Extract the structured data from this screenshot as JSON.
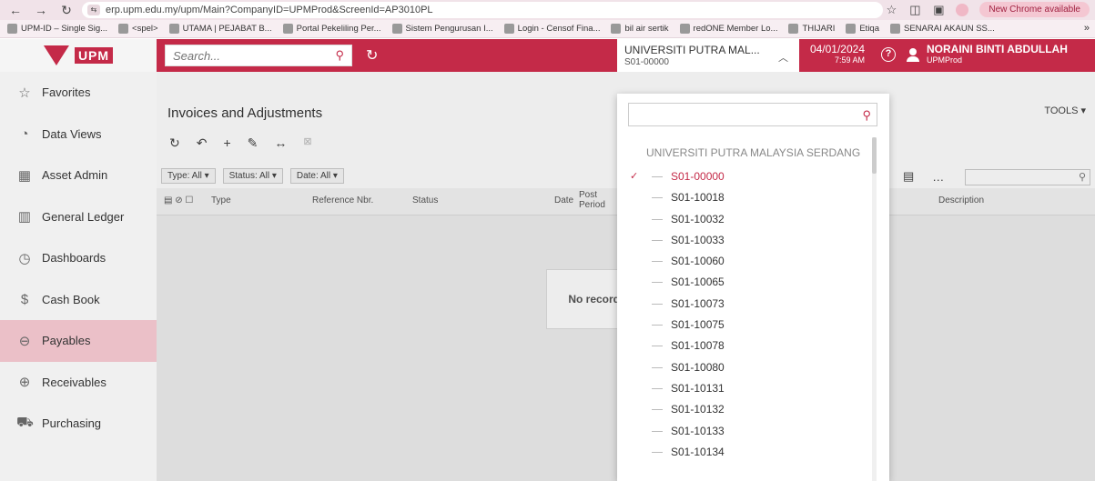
{
  "browser": {
    "url": "erp.upm.edu.my/upm/Main?CompanyID=UPMProd&ScreenId=AP3010PL",
    "update_label": "New Chrome available",
    "bookmarks": [
      "UPM-ID – Single Sig...",
      "<spel>",
      "UTAMA | PEJABAT B...",
      "Portal Pekeliling Per...",
      "Sistem Pengurusan I...",
      "Login - Censof Fina...",
      "bil air sertik",
      "redONE Member Lo...",
      "THIJARI",
      "Etiqa",
      "SENARAI AKAUN SS..."
    ],
    "more": "»"
  },
  "header": {
    "logo_text": "UPM",
    "search_placeholder": "Search...",
    "company_name": "UNIVERSITI PUTRA MAL...",
    "company_code": "S01-00000",
    "date": "04/01/2024",
    "time": "7:59 AM",
    "user_name": "NORAINI BINTI ABDULLAH",
    "user_company": "UPMProd"
  },
  "sidebar": {
    "items": [
      {
        "label": "Favorites",
        "icon": "☆"
      },
      {
        "label": "Data Views",
        "icon": "◔"
      },
      {
        "label": "Asset Admin",
        "icon": "▦"
      },
      {
        "label": "General Ledger",
        "icon": "▥"
      },
      {
        "label": "Dashboards",
        "icon": "◷"
      },
      {
        "label": "Cash Book",
        "icon": "$"
      },
      {
        "label": "Payables",
        "icon": "⊖"
      },
      {
        "label": "Receivables",
        "icon": "⊕"
      },
      {
        "label": "Purchasing",
        "icon": "⛟"
      }
    ]
  },
  "main": {
    "title": "Invoices and Adjustments",
    "tools_label": "TOOLS ▾",
    "filters": [
      "Type: All ▾",
      "Status: All ▾",
      "Date: All ▾"
    ],
    "columns": {
      "type": "Type",
      "ref": "Reference Nbr.",
      "status": "Status",
      "date": "Date",
      "post_period": "Post Period",
      "description": "Description"
    },
    "no_records": "No record"
  },
  "dropdown": {
    "search_value": "",
    "root_label": "UNIVERSITI PUTRA MALAYSIA SERDANG",
    "check": "✓",
    "items": [
      "S01-00000",
      "S01-10018",
      "S01-10032",
      "S01-10033",
      "S01-10060",
      "S01-10065",
      "S01-10073",
      "S01-10075",
      "S01-10078",
      "S01-10080",
      "S01-10131",
      "S01-10132",
      "S01-10133",
      "S01-10134"
    ]
  },
  "colors": {
    "brand": "#c42a48",
    "active_nav": "#ebc0c8"
  }
}
